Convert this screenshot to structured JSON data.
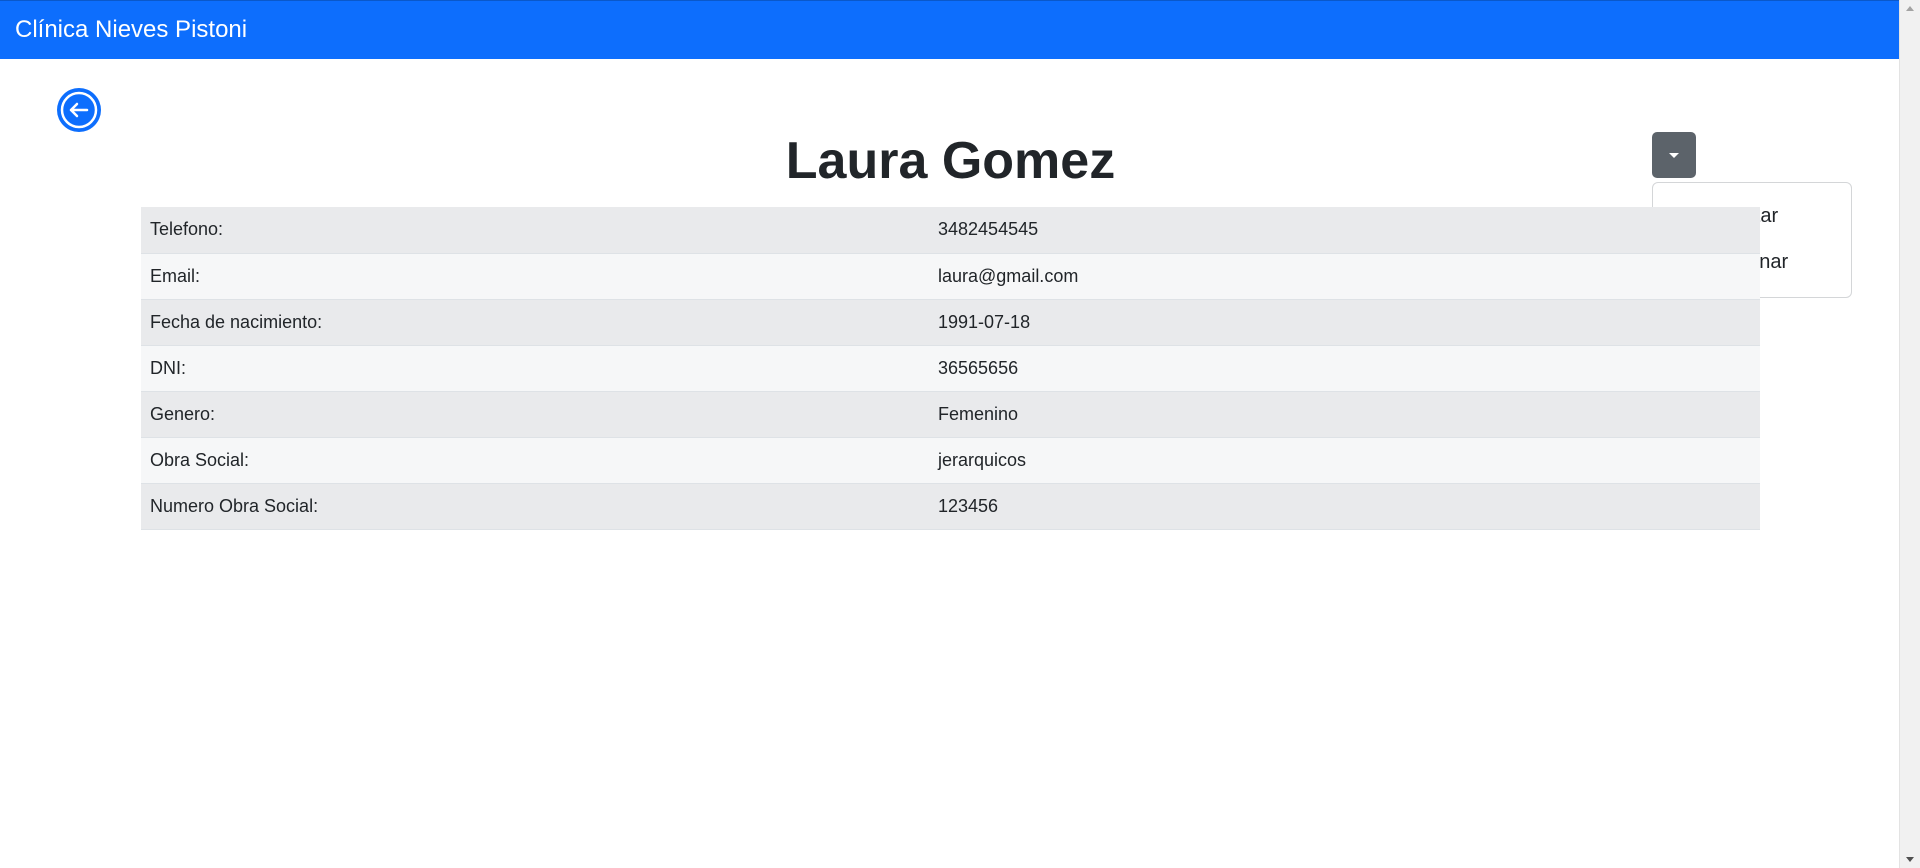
{
  "navbar": {
    "brand": "Clínica Nieves Pistoni"
  },
  "patient": {
    "name": "Laura Gomez"
  },
  "actions": {
    "menu": [
      {
        "label": "Editar"
      },
      {
        "label": "Eliminar"
      }
    ]
  },
  "details": {
    "rows": [
      {
        "label": "Telefono:",
        "value": "3482454545"
      },
      {
        "label": "Email:",
        "value": "laura@gmail.com"
      },
      {
        "label": "Fecha de nacimiento:",
        "value": "1991-07-18"
      },
      {
        "label": "DNI:",
        "value": "36565656"
      },
      {
        "label": "Genero:",
        "value": "Femenino"
      },
      {
        "label": "Obra Social:",
        "value": "jerarquicos"
      },
      {
        "label": "Numero Obra Social:",
        "value": "123456"
      }
    ]
  },
  "icons": {
    "back": "arrow-left-circle-icon",
    "toggle": "caret-down-icon"
  },
  "colors": {
    "primary": "#0d6efd",
    "secondary": "#5c636a"
  }
}
